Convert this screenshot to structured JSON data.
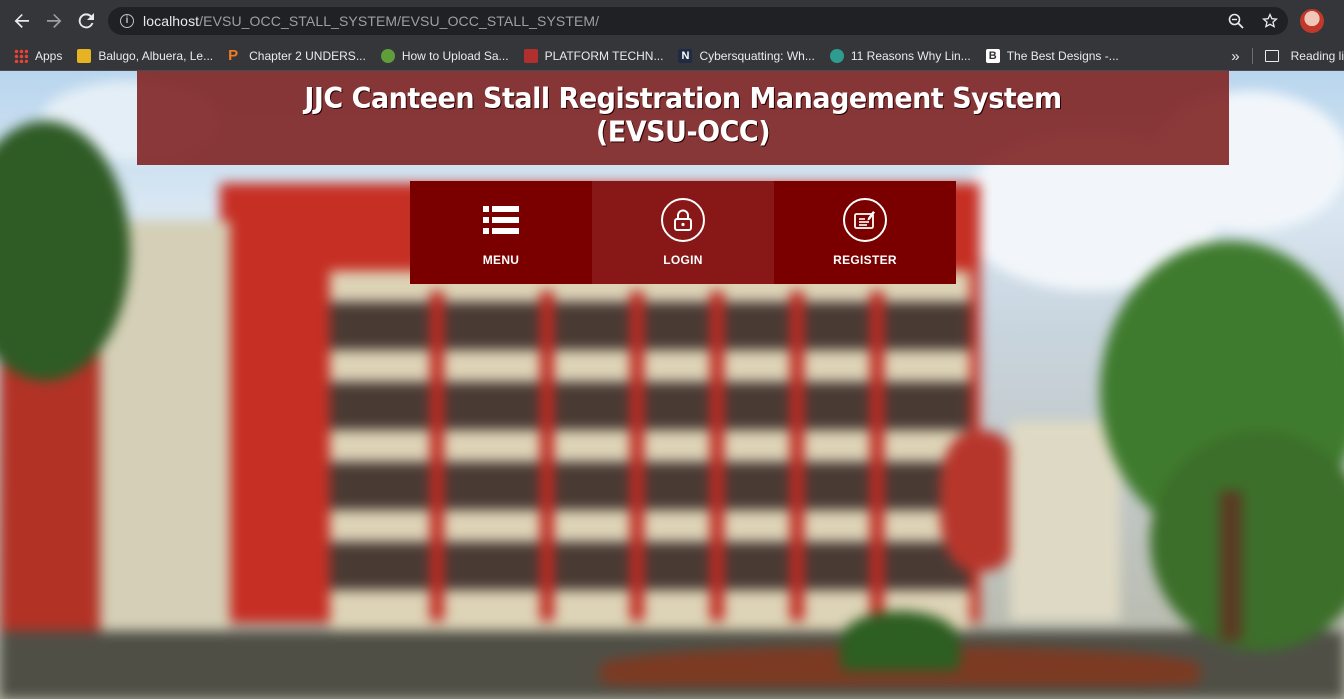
{
  "browser": {
    "url_host": "localhost",
    "url_path": "/EVSU_OCC_STALL_SYSTEM/EVSU_OCC_STALL_SYSTEM/",
    "bookmarks": [
      {
        "label": "Apps",
        "color": "#ea4335"
      },
      {
        "label": "Balugo, Albuera, Le...",
        "color": "#e6b422"
      },
      {
        "label": "Chapter 2 UNDERS...",
        "color": "#f07b22"
      },
      {
        "label": "How to Upload Sa...",
        "color": "#5f9e3a"
      },
      {
        "label": "PLATFORM TECHN...",
        "color": "#b03030"
      },
      {
        "label": "Cybersquatting: Wh...",
        "color": "#1f2a44"
      },
      {
        "label": "11 Reasons Why Lin...",
        "color": "#2e9d8f"
      },
      {
        "label": "The Best Designs -...",
        "color": "#ffffff"
      }
    ],
    "overflow_label": "»",
    "reading_list_label": "Reading li"
  },
  "header": {
    "title_line1": "JJC Canteen Stall Registration Management System",
    "title_line2": "(EVSU-OCC)"
  },
  "nav": [
    {
      "label": "MENU",
      "icon": "list-icon"
    },
    {
      "label": "LOGIN",
      "icon": "lock-icon"
    },
    {
      "label": "REGISTER",
      "icon": "register-card-icon"
    }
  ],
  "colors": {
    "header_bg": "#822828",
    "nav_dark": "#7a0000",
    "nav_mid": "#881818"
  }
}
